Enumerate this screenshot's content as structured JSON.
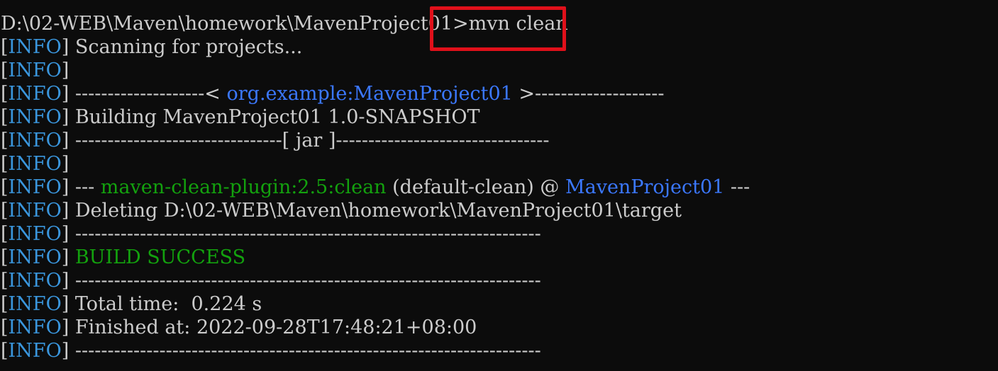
{
  "prompt": {
    "path": "D:\\02-WEB\\Maven\\homework\\MavenProject01>",
    "command": "mvn clean"
  },
  "info_tag": "INFO",
  "lines": {
    "l1": "Scanning for projects...",
    "l3_pre": "--------------------< ",
    "l3_artifact": "org.example:MavenProject01",
    "l3_post": " >--------------------",
    "l4": "Building MavenProject01 1.0-SNAPSHOT",
    "l5": "--------------------------------[ jar ]---------------------------------",
    "l7_pre": "--- ",
    "l7_plugin": "maven-clean-plugin:2.5:clean",
    "l7_mid": " (default-clean) @ ",
    "l7_project": "MavenProject01",
    "l7_post": " ---",
    "l8": "Deleting D:\\02-WEB\\Maven\\homework\\MavenProject01\\target",
    "l9": "------------------------------------------------------------------------",
    "l10": "BUILD SUCCESS",
    "l11": "------------------------------------------------------------------------",
    "l12": "Total time:  0.224 s",
    "l13": "Finished at: 2022-09-28T17:48:21+08:00",
    "l14": "------------------------------------------------------------------------"
  },
  "colors": {
    "background": "#0c0c0c",
    "text": "#cccccc",
    "info": "#3a96dd",
    "artifact": "#3b78ff",
    "success": "#13a10e",
    "highlight": "#e0101a"
  }
}
